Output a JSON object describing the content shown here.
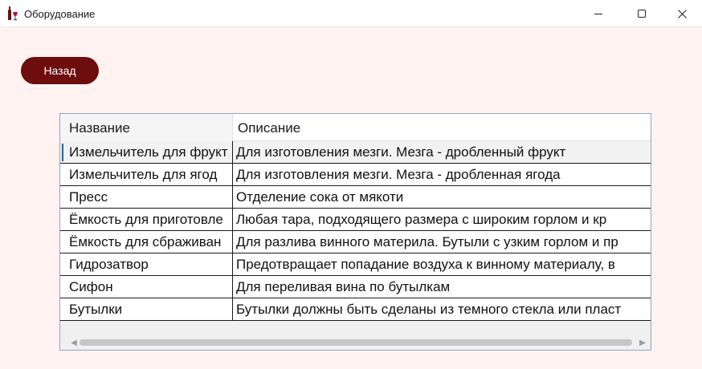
{
  "window": {
    "title": "Оборудование",
    "icon": "wine-bottle-glass-icon",
    "controls": [
      "minimize-icon",
      "maximize-icon",
      "close-icon"
    ]
  },
  "toolbar": {
    "back_label": "Назад"
  },
  "colors": {
    "accent": "#6e0d0d",
    "background": "#fff2f0",
    "grid_border": "#8ea6c4"
  },
  "table": {
    "columns": [
      "Название",
      "Описание"
    ],
    "selected_row": 0,
    "rows": [
      {
        "name": "Измельчитель для фрукт",
        "description": "Для изготовления мезги. Мезга - дробленный фрукт"
      },
      {
        "name": "Измельчитель для ягод",
        "description": "Для изготовления мезги. Мезга - дробленная ягода"
      },
      {
        "name": "Пресс",
        "description": "Отделение сока от мякоти"
      },
      {
        "name": "Ёмкость для приготовле",
        "description": "Любая тара, подходящего размера с широким горлом и кр"
      },
      {
        "name": "Ёмкость для сбраживан",
        "description": "Для разлива винного материла. Бутыли с узким горлом и пр"
      },
      {
        "name": "Гидрозатвор",
        "description": "Предотвращает попадание воздуха к винному материалу, в"
      },
      {
        "name": "Сифон",
        "description": "Для переливая вина по бутылкам"
      },
      {
        "name": "Бутылки",
        "description": "Бутылки должны быть сделаны из темного стекла или пласт"
      }
    ]
  }
}
